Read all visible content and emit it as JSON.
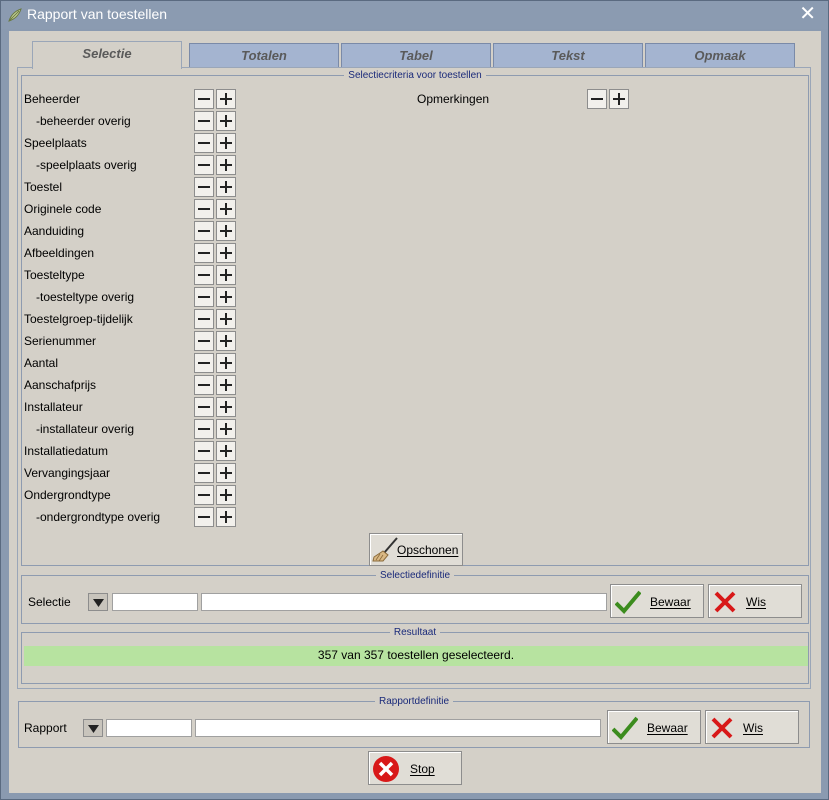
{
  "window": {
    "title": "Rapport van toestellen",
    "close": "✕"
  },
  "tabs": [
    "Selectie",
    "Totalen",
    "Tabel",
    "Tekst",
    "Opmaak"
  ],
  "criteria": {
    "legend": "Selectiecriteria voor toestellen",
    "left": [
      "Beheerder",
      "-beheerder overig",
      "Speelplaats",
      "-speelplaats overig",
      "Toestel",
      "Originele code",
      "Aanduiding",
      "Afbeeldingen",
      "Toesteltype",
      "-toesteltype overig",
      "Toestelgroep-tijdelijk",
      "Serienummer",
      "Aantal",
      "Aanschafprijs",
      "Installateur",
      "-installateur overig",
      "Installatiedatum",
      "Vervangingsjaar",
      "Ondergrondtype",
      "-ondergrondtype overig"
    ],
    "right": [
      "Opmerkingen"
    ],
    "clean_button": "Opschonen",
    "clean_icon": "broom-icon"
  },
  "selectie_def": {
    "legend": "Selectiedefinitie",
    "label": "Selectie",
    "code_value": "",
    "name_value": "",
    "save": "Bewaar",
    "clear": "Wis"
  },
  "result": {
    "legend": "Resultaat",
    "text": "357 van 357 toestellen geselecteerd.",
    "bar_color": "#b7e3a0"
  },
  "rapport_def": {
    "legend": "Rapportdefinitie",
    "label": "Rapport",
    "code_value": "",
    "name_value": "",
    "save": "Bewaar",
    "clear": "Wis"
  },
  "stop": "Stop",
  "colors": {
    "accent": "#8b9bb1",
    "check": "#3c8c1e",
    "cross": "#d81818",
    "stop": "#d81818"
  }
}
